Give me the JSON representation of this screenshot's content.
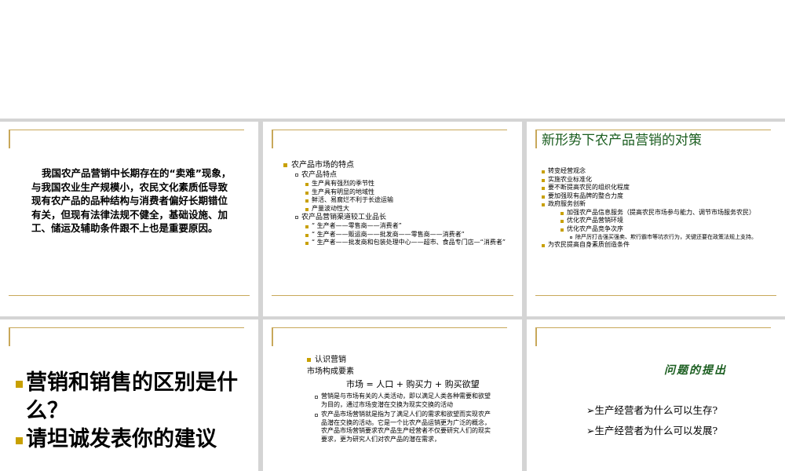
{
  "slide1": {
    "paragraph": "我国农产品营销中长期存在的“卖难”现象，与我国农业生产规模小，农民文化素质低导致现有农产品的品种结构与消费者偏好长期错位有关，但现有法律法规不健全，基础设施、加工、储运及辅助条件跟不上也是重要原因。"
  },
  "slide2": {
    "heading": "农产品市场的特点",
    "sub1": "农产品特点",
    "sub1_items": [
      "生产具有强烈的季节性",
      "生产具有明显的地域性",
      "鲜活、易腐烂不利于长途运输",
      "产量波动性大"
    ],
    "sub2": "农产品营销渠道较工业品长",
    "sub2_items": [
      "“ 生产者——零售商——消费者”",
      "“ 生产者——贩运商——批发商——零售商——消费者”",
      "“ 生产者——批发商和包装处理中心——超市、食品专门店—“消费者”"
    ]
  },
  "slide3": {
    "title": "新形势下农产品营销的对策",
    "items": [
      "转变经营观念",
      "实施农业标准化",
      "要不断提高农民的组织化程度",
      "要加强现有品牌的整合力度",
      "政府服务创新"
    ],
    "sub_items": [
      "加强农产品信息服务（提高农民市场参与能力、调节市场服务农民）",
      "优化农产品营销环境",
      "优化农产品竞争次序"
    ],
    "subsub": "除严厉打击强买强卖、欺行霸市等坑农行为，关键还要在政策法规上支持。",
    "last": "为农民提高自身素质创造条件"
  },
  "slide4": {
    "lines": [
      "营销和销售的区别是什么？",
      "请坦诚发表你的建议"
    ]
  },
  "slide5": {
    "heading": "认识营销",
    "subheading": "市场构成要素",
    "formula": "市场 = 人口 + 购买力 + 购买欲望",
    "items": [
      "营销是与市场有关的人类活动，即以满足人类各种需要和欲望为目的，通过市场变潜在交换为现实交换的活动",
      "农产品市场营销就是指为了满足人们的需求和欲望而实现农产品潜在交换的活动。它是一个比农产品运销更为广泛的概念，农产品市场营销要求农产品生产经营者不仅要研究人们的现实要求，更为研究人们对农产品的潜在需求，"
    ]
  },
  "slide6": {
    "title": "问题的提出",
    "questions": [
      "生产经营者为什么可以生存?",
      "生产经营者为什么可以发展?"
    ]
  },
  "colors": {
    "accent": "#c8a85a",
    "bullet": "#c8a000",
    "title_green": "#1b5e20"
  }
}
